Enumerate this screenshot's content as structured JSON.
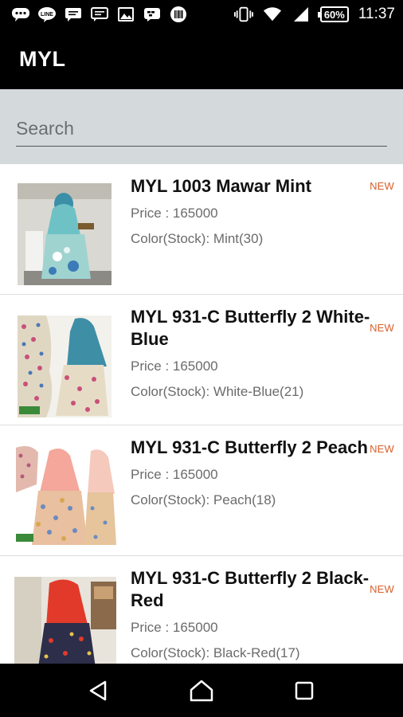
{
  "status_bar": {
    "time": "11:37",
    "battery": "60%",
    "icons": [
      "chat-icon",
      "line-icon",
      "sms-icon",
      "messages-icon",
      "gallery-icon",
      "bbm-icon",
      "barcode-icon",
      "vibrate-icon",
      "wifi-icon",
      "signal-icon",
      "battery-icon"
    ]
  },
  "app_bar": {
    "title": "MYL"
  },
  "search": {
    "placeholder": "Search",
    "value": ""
  },
  "products": [
    {
      "name": "MYL 1003 Mawar Mint",
      "price": "Price : 165000",
      "color_stock": "Color(Stock): Mint(30)",
      "badge": "NEW",
      "thumb_colors": [
        "#9fd3d0",
        "#3b8fa8",
        "#e8e8e8"
      ]
    },
    {
      "name": "MYL 931-C Butterfly 2 White-Blue",
      "price": "Price : 165000",
      "color_stock": "Color(Stock): White-Blue(21)",
      "badge": "NEW",
      "thumb_colors": [
        "#3e8ea6",
        "#e0d7c3",
        "#c94f7a"
      ]
    },
    {
      "name": "MYL 931-C Butterfly 2 Peach",
      "price": "Price : 165000",
      "color_stock": "Color(Stock): Peach(18)",
      "badge": "NEW",
      "thumb_colors": [
        "#f4a79a",
        "#f6c9bd",
        "#d8a74f"
      ]
    },
    {
      "name": "MYL 931-C Butterfly 2 Black-Red",
      "price": "Price : 165000",
      "color_stock": "Color(Stock): Black-Red(17)",
      "badge": "NEW",
      "thumb_colors": [
        "#e23a2a",
        "#2c2e4a",
        "#8a6a4a"
      ]
    }
  ],
  "nav_bar": {
    "buttons": [
      "back-icon",
      "home-icon",
      "recents-icon"
    ]
  }
}
